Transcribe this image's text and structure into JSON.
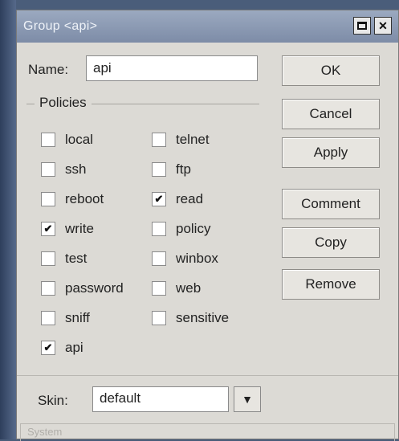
{
  "window": {
    "title": "Group <api>"
  },
  "name_field": {
    "label": "Name:",
    "value": "api"
  },
  "policies": {
    "legend": "Policies",
    "left_column": [
      {
        "label": "local",
        "checked": false
      },
      {
        "label": "ssh",
        "checked": false
      },
      {
        "label": "reboot",
        "checked": false
      },
      {
        "label": "write",
        "checked": true
      },
      {
        "label": "test",
        "checked": false
      },
      {
        "label": "password",
        "checked": false
      },
      {
        "label": "sniff",
        "checked": false
      },
      {
        "label": "api",
        "checked": true
      }
    ],
    "right_column": [
      {
        "label": "telnet",
        "checked": false
      },
      {
        "label": "ftp",
        "checked": false
      },
      {
        "label": "read",
        "checked": true
      },
      {
        "label": "policy",
        "checked": false
      },
      {
        "label": "winbox",
        "checked": false
      },
      {
        "label": "web",
        "checked": false
      },
      {
        "label": "sensitive",
        "checked": false
      }
    ]
  },
  "buttons": {
    "ok": "OK",
    "cancel": "Cancel",
    "apply": "Apply",
    "comment": "Comment",
    "copy": "Copy",
    "remove": "Remove"
  },
  "skin": {
    "label": "Skin:",
    "value": "default"
  },
  "status": {
    "text": "System"
  },
  "icons": {
    "close": "close-icon",
    "maximize": "maximize-icon",
    "dropdown": "dropdown-arrow-icon"
  },
  "colors": {
    "titlebar": "#8c9ab3",
    "window_bg": "#dcdad5"
  }
}
